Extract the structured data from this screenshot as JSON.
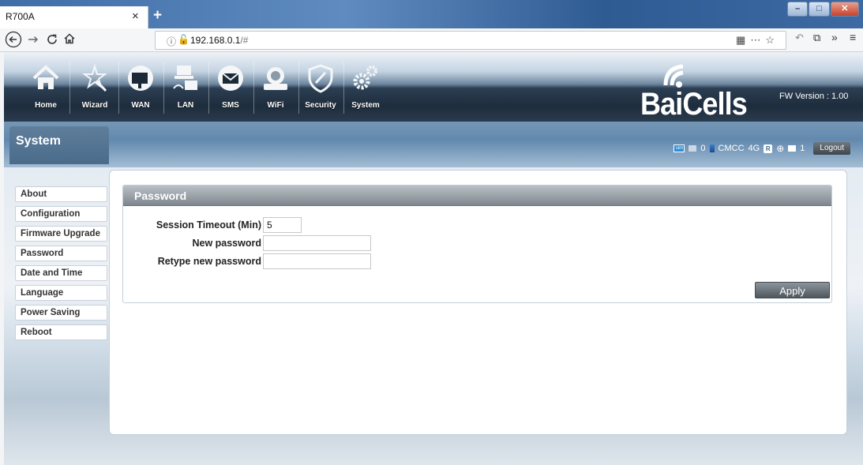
{
  "browser": {
    "tab_title": "R700A",
    "tab_close": "×",
    "new_tab": "+",
    "url_host": "192.168.0.1",
    "url_hash": "/#",
    "window_buttons": [
      "–",
      "□",
      "✕"
    ],
    "nav_icons": [
      "back-icon",
      "forward-icon",
      "reload-icon",
      "home-icon"
    ],
    "toolbar_icons": [
      "qr-icon",
      "more-icon",
      "bookmark-star-icon",
      "reader-icon",
      "screenshot-icon",
      "overflow-icon",
      "menu-icon"
    ]
  },
  "header": {
    "menu": [
      {
        "label": "Home",
        "icon": "home-icon"
      },
      {
        "label": "Wizard",
        "icon": "wizard-icon"
      },
      {
        "label": "WAN",
        "icon": "wan-icon"
      },
      {
        "label": "LAN",
        "icon": "lan-icon"
      },
      {
        "label": "SMS",
        "icon": "sms-icon"
      },
      {
        "label": "WiFi",
        "icon": "wifi-icon"
      },
      {
        "label": "Security",
        "icon": "security-icon"
      },
      {
        "label": "System",
        "icon": "system-icon"
      }
    ],
    "logo_text": "BaiCells",
    "fw_version": "FW Version : 1.00"
  },
  "band": {
    "section_title": "System",
    "status": {
      "sim_label": "sim",
      "sms_count": "0",
      "operator": "CMCC",
      "network": "4G",
      "roaming": "R",
      "devices_count": "1",
      "logout_label": "Logout"
    }
  },
  "sidebar": {
    "items": [
      {
        "label": "About"
      },
      {
        "label": "Configuration"
      },
      {
        "label": "Firmware Upgrade"
      },
      {
        "label": "Password"
      },
      {
        "label": "Date and Time"
      },
      {
        "label": "Language"
      },
      {
        "label": "Power Saving"
      },
      {
        "label": "Reboot"
      }
    ]
  },
  "main": {
    "panel_title": "Password",
    "fields": {
      "timeout_label": "Session Timeout (Min)",
      "timeout_value": "5",
      "new_password_label": "New password",
      "new_password_value": "",
      "retype_label": "Retype new password",
      "retype_value": ""
    },
    "apply_label": "Apply"
  },
  "colors": {
    "header_dark": "#1e2d3d",
    "band_blue": "#6289ae",
    "panel_head": "#7f868d"
  }
}
